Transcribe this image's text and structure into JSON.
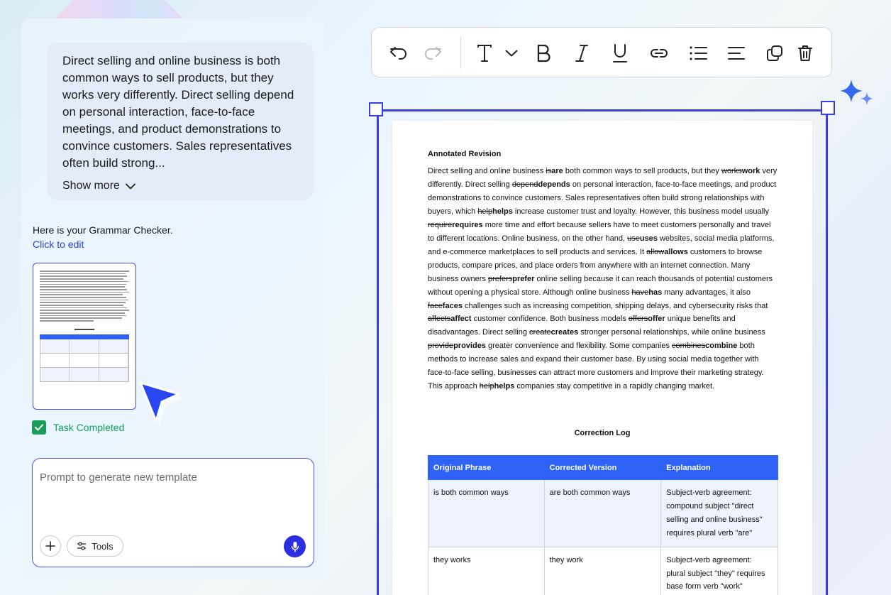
{
  "chat": {
    "message": "Direct selling and online business is both common ways to sell products, but they works very differently. Direct selling depend on personal interaction, face-to-face meetings, and product demonstrations to convince customers. Sales representatives often build strong...",
    "show_more": "Show more",
    "intro": "Here is your Grammar Checker.",
    "click_to_edit": "Click to edit",
    "task_status": "Task Completed"
  },
  "prompt": {
    "placeholder": "Prompt to generate new template",
    "tools_label": "Tools"
  },
  "toolbar": {
    "icons": [
      "undo-icon",
      "redo-icon",
      "text-style-icon",
      "bold-icon",
      "italic-icon",
      "underline-icon",
      "link-icon",
      "list-icon",
      "align-icon",
      "duplicate-icon",
      "delete-icon"
    ]
  },
  "document": {
    "title": "Annotated Revision",
    "paragraph": [
      {
        "t": "Direct selling and online business "
      },
      {
        "del": "is"
      },
      {
        "ins": "are"
      },
      {
        "t": " both common ways to sell products, but they "
      },
      {
        "del": "works"
      },
      {
        "ins": "work"
      },
      {
        "t": " very differently. Direct selling "
      },
      {
        "del": "depend"
      },
      {
        "ins": "depends"
      },
      {
        "t": " on personal interaction, face-to-face meetings, and product demonstrations to convince customers. Sales representatives often build strong relationships with buyers, which "
      },
      {
        "del": "help"
      },
      {
        "ins": "helps"
      },
      {
        "t": " increase customer trust and loyalty. However, this business model usually "
      },
      {
        "del": "require"
      },
      {
        "ins": "requires"
      },
      {
        "t": " more time and effort because sellers have to meet customers personally and travel to different locations. Online business, on the other hand, "
      },
      {
        "del": "use"
      },
      {
        "ins": "uses"
      },
      {
        "t": " websites, social media platforms, and e-commerce marketplaces to sell products and services. It "
      },
      {
        "del": "allow"
      },
      {
        "ins": "allows"
      },
      {
        "t": " customers to browse products, compare prices, and place orders from anywhere with an internet connection. Many business owners "
      },
      {
        "del": "prefers"
      },
      {
        "ins": "prefer"
      },
      {
        "t": " online selling because it can reach thousands of potential customers without opening a physical store. Although online business "
      },
      {
        "del": "have"
      },
      {
        "ins": "has"
      },
      {
        "t": " many advantages, it also "
      },
      {
        "del": "face"
      },
      {
        "ins": "faces"
      },
      {
        "t": " challenges such as increasing competition, shipping delays, and cybersecurity risks that "
      },
      {
        "del": "affects"
      },
      {
        "ins": "affect"
      },
      {
        "t": " customer confidence. Both business models "
      },
      {
        "del": "offers"
      },
      {
        "ins": "offer"
      },
      {
        "t": " unique benefits and disadvantages. Direct selling "
      },
      {
        "del": "create"
      },
      {
        "ins": "creates"
      },
      {
        "t": " stronger personal relationships, while online business "
      },
      {
        "del": "provide"
      },
      {
        "ins": "provides"
      },
      {
        "t": " greater convenience and flexibility. Some companies "
      },
      {
        "del": "combines"
      },
      {
        "ins": "combine"
      },
      {
        "t": " both methods to increase sales and expand their customer base. By using social media together with face-to-face selling, businesses can attract more customers and improve their marketing strategy. This approach "
      },
      {
        "del": "help"
      },
      {
        "ins": "helps"
      },
      {
        "t": " companies stay competitive in a rapidly changing market."
      }
    ],
    "log_title": "Correction Log",
    "log_headers": [
      "Original Phrase",
      "Corrected Version",
      "Explanation"
    ],
    "log_rows": [
      [
        "is both common ways",
        "are both common ways",
        "Subject-verb agreement: compound subject \"direct selling and online business\" requires plural verb \"are\""
      ],
      [
        "they works",
        "they work",
        "Subject-verb agreement: plural subject \"they\" requires base form verb \"work\""
      ]
    ]
  },
  "colors": {
    "accent": "#3a3ee0",
    "table_header": "#2f62f6",
    "success": "#15a05a",
    "link": "#2643d6"
  }
}
